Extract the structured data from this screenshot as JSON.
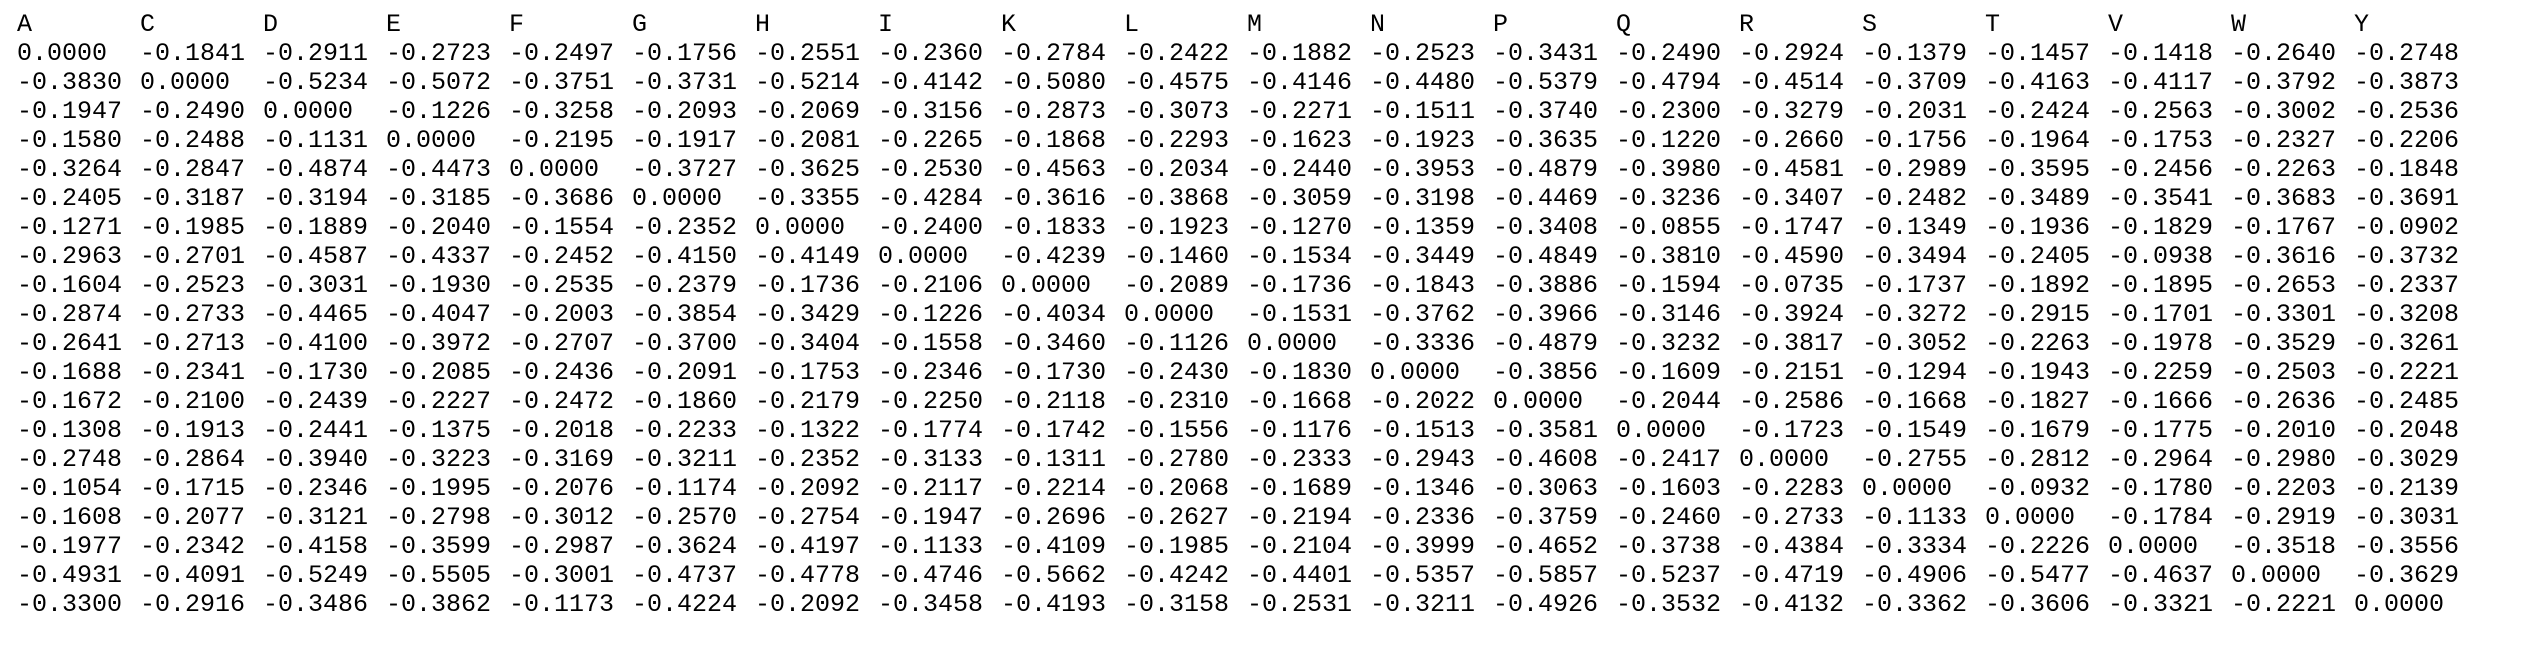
{
  "headers": [
    "A",
    "C",
    "D",
    "E",
    "F",
    "G",
    "H",
    "I",
    "K",
    "L",
    "M",
    "N",
    "P",
    "Q",
    "R",
    "S",
    "T",
    "V",
    "W",
    "Y"
  ],
  "rows": [
    [
      "0.0000",
      "-0.1841",
      "-0.2911",
      "-0.2723",
      "-0.2497",
      "-0.1756",
      "-0.2551",
      "-0.2360",
      "-0.2784",
      "-0.2422",
      "-0.1882",
      "-0.2523",
      "-0.3431",
      "-0.2490",
      "-0.2924",
      "-0.1379",
      "-0.1457",
      "-0.1418",
      "-0.2640",
      "-0.2748"
    ],
    [
      "-0.3830",
      "0.0000",
      "-0.5234",
      "-0.5072",
      "-0.3751",
      "-0.3731",
      "-0.5214",
      "-0.4142",
      "-0.5080",
      "-0.4575",
      "-0.4146",
      "-0.4480",
      "-0.5379",
      "-0.4794",
      "-0.4514",
      "-0.3709",
      "-0.4163",
      "-0.4117",
      "-0.3792",
      "-0.3873"
    ],
    [
      "-0.1947",
      "-0.2490",
      "0.0000",
      "-0.1226",
      "-0.3258",
      "-0.2093",
      "-0.2069",
      "-0.3156",
      "-0.2873",
      "-0.3073",
      "-0.2271",
      "-0.1511",
      "-0.3740",
      "-0.2300",
      "-0.3279",
      "-0.2031",
      "-0.2424",
      "-0.2563",
      "-0.3002",
      "-0.2536"
    ],
    [
      "-0.1580",
      "-0.2488",
      "-0.1131",
      "0.0000",
      "-0.2195",
      "-0.1917",
      "-0.2081",
      "-0.2265",
      "-0.1868",
      "-0.2293",
      "-0.1623",
      "-0.1923",
      "-0.3635",
      "-0.1220",
      "-0.2660",
      "-0.1756",
      "-0.1964",
      "-0.1753",
      "-0.2327",
      "-0.2206"
    ],
    [
      "-0.3264",
      "-0.2847",
      "-0.4874",
      "-0.4473",
      "0.0000",
      "-0.3727",
      "-0.3625",
      "-0.2530",
      "-0.4563",
      "-0.2034",
      "-0.2440",
      "-0.3953",
      "-0.4879",
      "-0.3980",
      "-0.4581",
      "-0.2989",
      "-0.3595",
      "-0.2456",
      "-0.2263",
      "-0.1848"
    ],
    [
      "-0.2405",
      "-0.3187",
      "-0.3194",
      "-0.3185",
      "-0.3686",
      "0.0000",
      "-0.3355",
      "-0.4284",
      "-0.3616",
      "-0.3868",
      "-0.3059",
      "-0.3198",
      "-0.4469",
      "-0.3236",
      "-0.3407",
      "-0.2482",
      "-0.3489",
      "-0.3541",
      "-0.3683",
      "-0.3691"
    ],
    [
      "-0.1271",
      "-0.1985",
      "-0.1889",
      "-0.2040",
      "-0.1554",
      "-0.2352",
      "0.0000",
      "-0.2400",
      "-0.1833",
      "-0.1923",
      "-0.1270",
      "-0.1359",
      "-0.3408",
      "-0.0855",
      "-0.1747",
      "-0.1349",
      "-0.1936",
      "-0.1829",
      "-0.1767",
      "-0.0902"
    ],
    [
      "-0.2963",
      "-0.2701",
      "-0.4587",
      "-0.4337",
      "-0.2452",
      "-0.4150",
      "-0.4149",
      "0.0000",
      "-0.4239",
      "-0.1460",
      "-0.1534",
      "-0.3449",
      "-0.4849",
      "-0.3810",
      "-0.4590",
      "-0.3494",
      "-0.2405",
      "-0.0938",
      "-0.3616",
      "-0.3732"
    ],
    [
      "-0.1604",
      "-0.2523",
      "-0.3031",
      "-0.1930",
      "-0.2535",
      "-0.2379",
      "-0.1736",
      "-0.2106",
      "0.0000",
      "-0.2089",
      "-0.1736",
      "-0.1843",
      "-0.3886",
      "-0.1594",
      "-0.0735",
      "-0.1737",
      "-0.1892",
      "-0.1895",
      "-0.2653",
      "-0.2337"
    ],
    [
      "-0.2874",
      "-0.2733",
      "-0.4465",
      "-0.4047",
      "-0.2003",
      "-0.3854",
      "-0.3429",
      "-0.1226",
      "-0.4034",
      "0.0000",
      "-0.1531",
      "-0.3762",
      "-0.3966",
      "-0.3146",
      "-0.3924",
      "-0.3272",
      "-0.2915",
      "-0.1701",
      "-0.3301",
      "-0.3208"
    ],
    [
      "-0.2641",
      "-0.2713",
      "-0.4100",
      "-0.3972",
      "-0.2707",
      "-0.3700",
      "-0.3404",
      "-0.1558",
      "-0.3460",
      "-0.1126",
      "0.0000",
      "-0.3336",
      "-0.4879",
      "-0.3232",
      "-0.3817",
      "-0.3052",
      "-0.2263",
      "-0.1978",
      "-0.3529",
      "-0.3261"
    ],
    [
      "-0.1688",
      "-0.2341",
      "-0.1730",
      "-0.2085",
      "-0.2436",
      "-0.2091",
      "-0.1753",
      "-0.2346",
      "-0.1730",
      "-0.2430",
      "-0.1830",
      "0.0000",
      "-0.3856",
      "-0.1609",
      "-0.2151",
      "-0.1294",
      "-0.1943",
      "-0.2259",
      "-0.2503",
      "-0.2221"
    ],
    [
      "-0.1672",
      "-0.2100",
      "-0.2439",
      "-0.2227",
      "-0.2472",
      "-0.1860",
      "-0.2179",
      "-0.2250",
      "-0.2118",
      "-0.2310",
      "-0.1668",
      "-0.2022",
      "0.0000",
      "-0.2044",
      "-0.2586",
      "-0.1668",
      "-0.1827",
      "-0.1666",
      "-0.2636",
      "-0.2485"
    ],
    [
      "-0.1308",
      "-0.1913",
      "-0.2441",
      "-0.1375",
      "-0.2018",
      "-0.2233",
      "-0.1322",
      "-0.1774",
      "-0.1742",
      "-0.1556",
      "-0.1176",
      "-0.1513",
      "-0.3581",
      "0.0000",
      "-0.1723",
      "-0.1549",
      "-0.1679",
      "-0.1775",
      "-0.2010",
      "-0.2048"
    ],
    [
      "-0.2748",
      "-0.2864",
      "-0.3940",
      "-0.3223",
      "-0.3169",
      "-0.3211",
      "-0.2352",
      "-0.3133",
      "-0.1311",
      "-0.2780",
      "-0.2333",
      "-0.2943",
      "-0.4608",
      "-0.2417",
      "0.0000",
      "-0.2755",
      "-0.2812",
      "-0.2964",
      "-0.2980",
      "-0.3029"
    ],
    [
      "-0.1054",
      "-0.1715",
      "-0.2346",
      "-0.1995",
      "-0.2076",
      "-0.1174",
      "-0.2092",
      "-0.2117",
      "-0.2214",
      "-0.2068",
      "-0.1689",
      "-0.1346",
      "-0.3063",
      "-0.1603",
      "-0.2283",
      "0.0000",
      "-0.0932",
      "-0.1780",
      "-0.2203",
      "-0.2139"
    ],
    [
      "-0.1608",
      "-0.2077",
      "-0.3121",
      "-0.2798",
      "-0.3012",
      "-0.2570",
      "-0.2754",
      "-0.1947",
      "-0.2696",
      "-0.2627",
      "-0.2194",
      "-0.2336",
      "-0.3759",
      "-0.2460",
      "-0.2733",
      "-0.1133",
      "0.0000",
      "-0.1784",
      "-0.2919",
      "-0.3031"
    ],
    [
      "-0.1977",
      "-0.2342",
      "-0.4158",
      "-0.3599",
      "-0.2987",
      "-0.3624",
      "-0.4197",
      "-0.1133",
      "-0.4109",
      "-0.1985",
      "-0.2104",
      "-0.3999",
      "-0.4652",
      "-0.3738",
      "-0.4384",
      "-0.3334",
      "-0.2226",
      "0.0000",
      "-0.3518",
      "-0.3556"
    ],
    [
      "-0.4931",
      "-0.4091",
      "-0.5249",
      "-0.5505",
      "-0.3001",
      "-0.4737",
      "-0.4778",
      "-0.4746",
      "-0.5662",
      "-0.4242",
      "-0.4401",
      "-0.5357",
      "-0.5857",
      "-0.5237",
      "-0.4719",
      "-0.4906",
      "-0.5477",
      "-0.4637",
      "0.0000",
      "-0.3629"
    ],
    [
      "-0.3300",
      "-0.2916",
      "-0.3486",
      "-0.3862",
      "-0.1173",
      "-0.4224",
      "-0.2092",
      "-0.3458",
      "-0.4193",
      "-0.3158",
      "-0.2531",
      "-0.3211",
      "-0.4926",
      "-0.3532",
      "-0.4132",
      "-0.3362",
      "-0.3606",
      "-0.3321",
      "-0.2221",
      "0.0000"
    ]
  ]
}
